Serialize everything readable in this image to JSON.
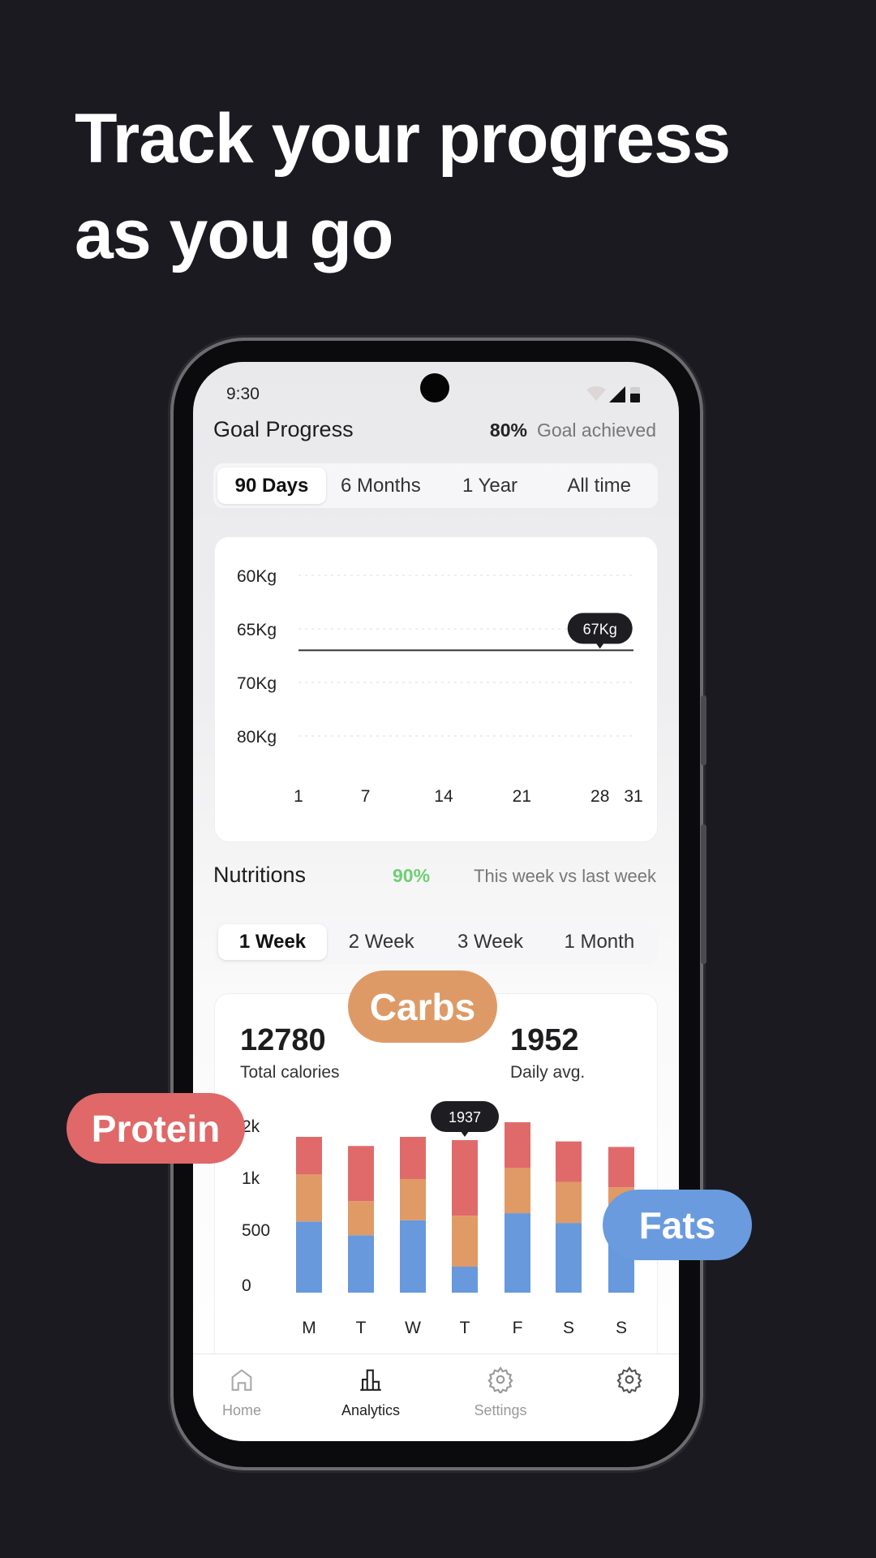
{
  "headline": [
    "Track your progress",
    "as you go"
  ],
  "status": {
    "time": "9:30"
  },
  "goal": {
    "title": "Goal Progress",
    "percent": "80%",
    "caption": "Goal achieved",
    "tabs": [
      "90 Days",
      "6 Months",
      "1 Year",
      "All time"
    ],
    "selected_tab": "90 Days"
  },
  "nutrition": {
    "title": "Nutritions",
    "percent": "90%",
    "percent_color": "#6fcf73",
    "caption": "This week vs last week",
    "tabs": [
      "1 Week",
      "2 Week",
      "3 Week",
      "1 Month"
    ],
    "selected_tab": "1 Week",
    "total_value": "12780",
    "total_label": "Total calories",
    "avg_value": "1952",
    "avg_label": "Daily avg."
  },
  "chart_data": [
    {
      "type": "line",
      "y_ticks": [
        "60Kg",
        "65Kg",
        "70Kg",
        "80Kg"
      ],
      "y_tick_values": [
        60,
        65,
        70,
        80
      ],
      "x_ticks": [
        "1",
        "7",
        "14",
        "21",
        "28",
        "31"
      ],
      "series": [
        {
          "x": [
            1,
            31
          ],
          "y": [
            67,
            67
          ]
        }
      ],
      "tooltip": {
        "x": 28,
        "label": "67Kg"
      },
      "grid": "dashed-horizontal"
    },
    {
      "type": "bar",
      "stacked": true,
      "categories": [
        "M",
        "T",
        "W",
        "T",
        "F",
        "S",
        "S"
      ],
      "y_ticks": [
        "0",
        "500",
        "1k",
        "2k"
      ],
      "y_tick_values": [
        0,
        500,
        1000,
        2000
      ],
      "series": [
        {
          "name": "Fats",
          "color": "#6799dc",
          "values": [
            685,
            553,
            697,
            250,
            765,
            671,
            640
          ]
        },
        {
          "name": "Carbs",
          "color": "#e09a66",
          "values": [
            590,
            329,
            491,
            491,
            635,
            458,
            389
          ]
        },
        {
          "name": "Protein",
          "color": "#e06a6a",
          "values": [
            725,
            942,
            812,
            1196,
            882,
            783,
            777
          ]
        }
      ],
      "tooltip": {
        "index": 3,
        "label": "1937"
      }
    }
  ],
  "bubbles": {
    "carbs": "Carbs",
    "protein": "Protein",
    "fats": "Fats",
    "colors": {
      "carbs": "#de9a66",
      "protein": "#e06868",
      "fats": "#6a9bde"
    }
  },
  "nav": [
    {
      "label": "Home",
      "icon": "home-icon",
      "active": false
    },
    {
      "label": "Analytics",
      "icon": "bar-chart-icon",
      "active": true
    },
    {
      "label": "Settings",
      "icon": "gear-icon",
      "active": false
    },
    {
      "label": "",
      "icon": "gear-icon",
      "active": false
    }
  ]
}
